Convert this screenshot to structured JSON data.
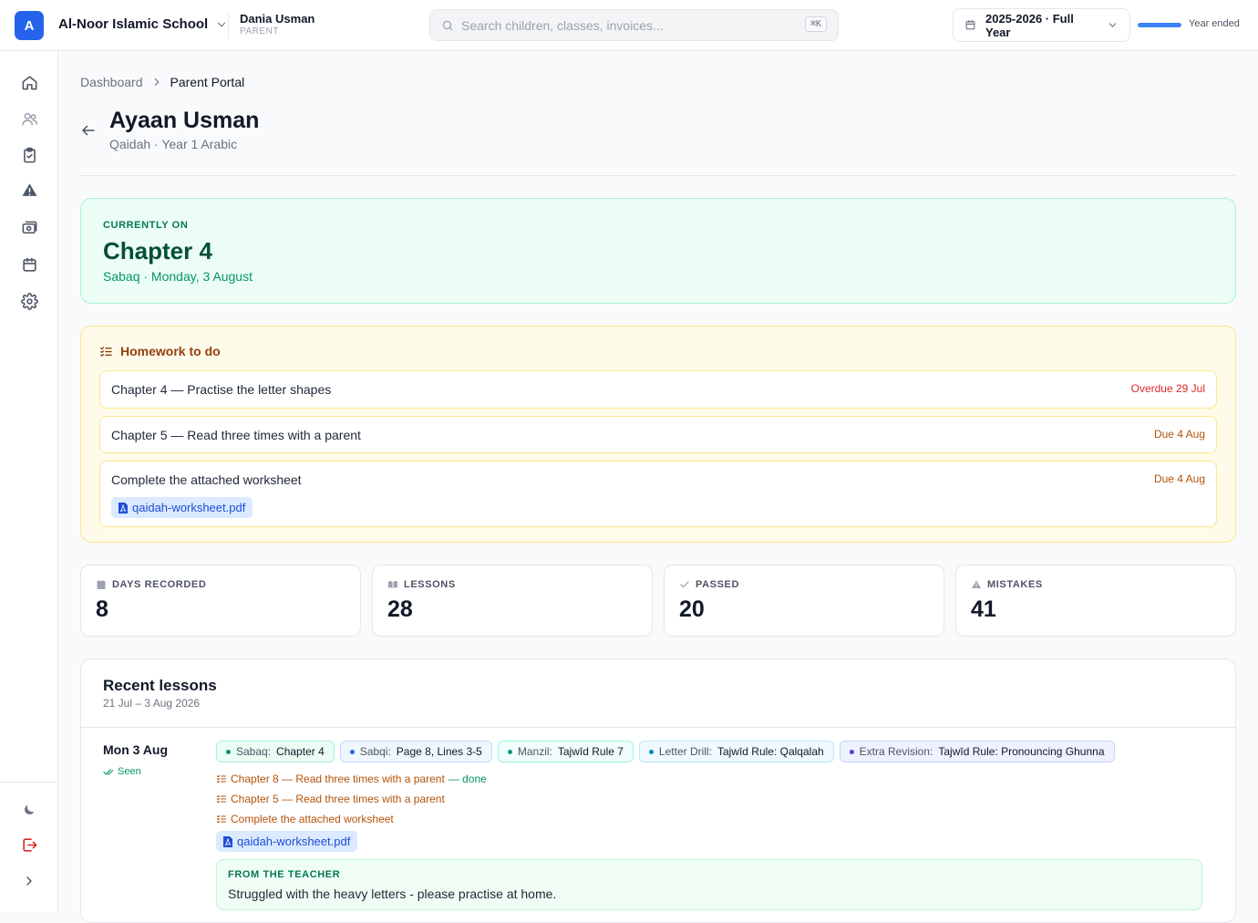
{
  "app": {
    "logo_letter": "A",
    "school_name": "Al-Noor Islamic School",
    "user_name": "Dania Usman",
    "user_role": "PARENT",
    "search_placeholder": "Search children, classes, invoices...",
    "search_shortcut": "⌘K",
    "year_label": "2025-2026 · Full Year",
    "year_progress": 1.0,
    "year_status": "Year ended",
    "accent_color": "#2563eb"
  },
  "sidebar": {
    "items": [
      "home-icon",
      "people-icon",
      "clipboard-check-icon",
      "warning-icon",
      "money-icon",
      "calendar-icon",
      "gear-icon"
    ],
    "bottom": [
      "moon-icon",
      "logout-icon",
      "chevron-right-icon"
    ]
  },
  "breadcrumb": {
    "root": "Dashboard",
    "current": "Parent Portal"
  },
  "child": {
    "name": "Ayaan Usman",
    "subtitle": "Qaidah · Year 1 Arabic"
  },
  "current": {
    "kicker": "CURRENTLY ON",
    "chapter": "Chapter 4",
    "detail": "Sabaq · Monday, 3 August"
  },
  "homework": {
    "title": "Homework to do",
    "items": [
      {
        "text": "Chapter 4 — Practise the letter shapes",
        "due": "Overdue 29 Jul",
        "status": "overdue"
      },
      {
        "text": "Chapter 5 — Read three times with a parent",
        "due": "Due 4 Aug",
        "status": "due"
      },
      {
        "text": "Complete the attached worksheet",
        "due": "Due 4 Aug",
        "status": "due",
        "attachment": "qaidah-worksheet.pdf"
      }
    ]
  },
  "stats": [
    {
      "label": "DAYS RECORDED",
      "value": "8",
      "icon": "calendar-icon"
    },
    {
      "label": "LESSONS",
      "value": "28",
      "icon": "book-icon"
    },
    {
      "label": "PASSED",
      "value": "20",
      "icon": "check-icon"
    },
    {
      "label": "MISTAKES",
      "value": "41",
      "icon": "warning-icon"
    }
  ],
  "recent": {
    "title": "Recent lessons",
    "range": "21 Jul – 3 Aug 2026",
    "day": "Mon 3 Aug",
    "seen": "Seen",
    "pills": [
      {
        "key": "Sabaq:",
        "value": "Chapter 4"
      },
      {
        "key": "Sabqi:",
        "value": "Page 8, Lines 3-5"
      },
      {
        "key": "Manzil:",
        "value": "Tajwīd Rule 7"
      },
      {
        "key": "Letter Drill:",
        "value": "Tajwīd Rule: Qalqalah"
      },
      {
        "key": "Extra Revision:",
        "value": "Tajwīd Rule: Pronouncing Ghunna"
      }
    ],
    "homework": [
      {
        "text": "Chapter 8 — Read three times with a parent",
        "suffix": " — done"
      },
      {
        "text": "Chapter 5 — Read three times with a parent",
        "suffix": ""
      },
      {
        "text": "Complete the attached worksheet",
        "suffix": ""
      }
    ],
    "attachment": "qaidah-worksheet.pdf",
    "teacher_label": "FROM THE TEACHER",
    "teacher_note": "Struggled with the heavy letters - please practise at home."
  }
}
